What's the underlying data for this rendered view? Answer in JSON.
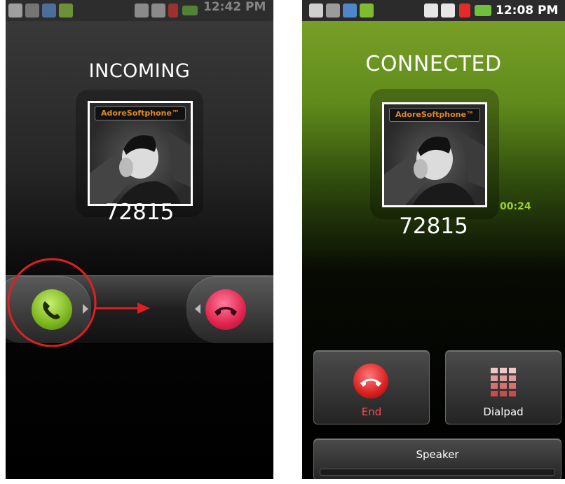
{
  "left_screen": {
    "call_state": "INCOMING",
    "caller_photo_brand": "AdoreSoftphone™",
    "caller_number": "72815",
    "status_bar": {
      "time": "12:42 PM"
    }
  },
  "right_screen": {
    "call_state": "CONNECTED",
    "caller_photo_brand": "AdoreSoftphone™",
    "caller_number": "72815",
    "call_timer": "00:24",
    "status_bar": {
      "time": "12:08 PM"
    },
    "buttons": {
      "end_label": "End",
      "dialpad_label": "Dialpad",
      "speaker_label": "Speaker"
    }
  },
  "colors": {
    "answer_green": "#8cc63f",
    "end_red": "#e0244d",
    "annotation_red": "#e02020",
    "timer_green": "#9bd12a",
    "brand_orange": "#e08a1e"
  },
  "icons": [
    "usb-icon",
    "settings-icon",
    "app-icon",
    "call-icon",
    "sim-icon",
    "sd-icon",
    "cross-icon",
    "battery-icon",
    "phone-answer-icon",
    "phone-hangup-icon",
    "dialpad-grid-icon",
    "arrow-right-icon"
  ]
}
